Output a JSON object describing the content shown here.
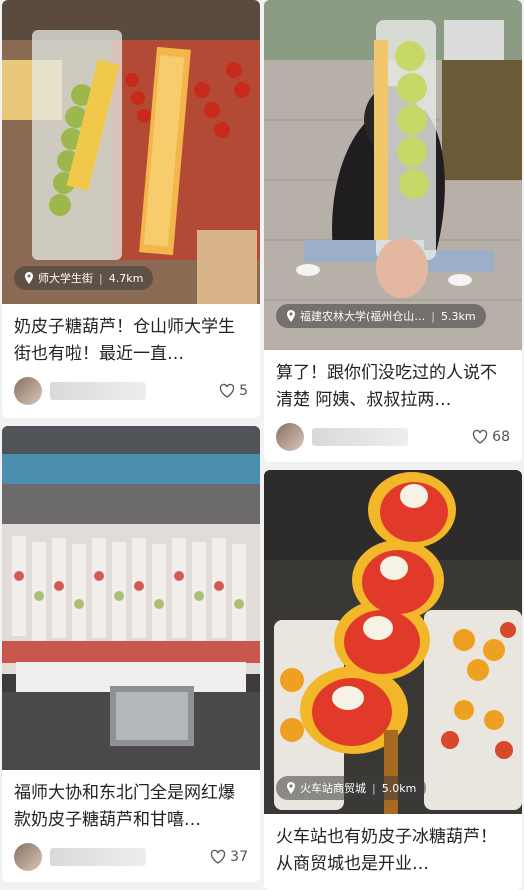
{
  "cards": [
    {
      "location": {
        "place": "师大学生街",
        "distance": "4.7km"
      },
      "title": "奶皮子糖葫芦！仓山师大学生街也有啦！最近一直…",
      "likes": "5",
      "image": "night-market-skewers"
    },
    {
      "location": {
        "place": "福建农林大学(福州仓山…",
        "distance": "5.3km"
      },
      "title": "算了！跟你们没吃过的人说不清楚 阿姨、叔叔拉两…",
      "likes": "68",
      "image": "person-holding-grape-skewer"
    },
    {
      "location": null,
      "title": "福师大协和东北门全是网红爆款奶皮子糖葫芦和甘嘻…",
      "likes": "37",
      "image": "stall-display-case"
    },
    {
      "location": {
        "place": "火车站商贸城",
        "distance": "5.0km"
      },
      "title": "火车站也有奶皮子冰糖葫芦！从商贸城也是开业…",
      "likes": "",
      "image": "strawberry-candy-skewers"
    }
  ],
  "colors": {
    "accent": "#222222",
    "pill_bg": "rgba(60,60,60,0.55)"
  }
}
